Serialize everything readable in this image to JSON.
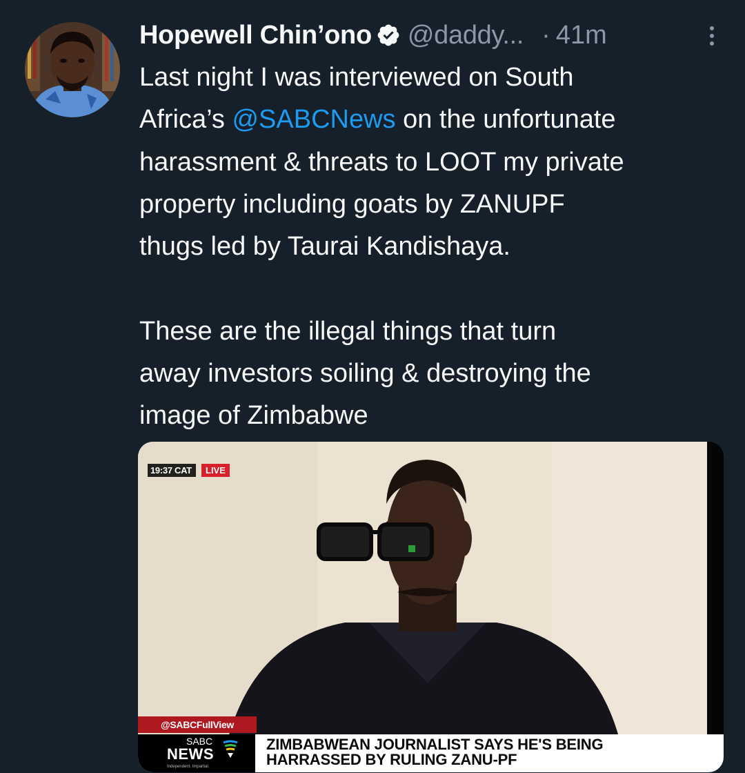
{
  "tweet": {
    "author_name": "Hopewell Chin’ono",
    "handle": "@daddy...",
    "separator": "·",
    "time": "41m",
    "text_lines": [
      "Last night I was interviewed on South",
      "Africa’s ",
      " on the unfortunate",
      "harassment & threats to LOOT my private",
      "property including goats by ZANUPF",
      "thugs led by Taurai Kandishaya.",
      "These are the illegal things that turn",
      "away investors soiling & destroying the",
      "image of Zimbabwe"
    ],
    "mention": "@SABCNews"
  },
  "video": {
    "timestamp": "19:37 CAT",
    "live_label": "LIVE",
    "channel_handle": "@SABCFullView",
    "logo_top": "SABC",
    "logo_main": "NEWS",
    "logo_tagline": "Independent. Impartial.",
    "headline_line1": "ZIMBABWEAN JOURNALIST SAYS HE'S BEING",
    "headline_line2": "HARRASSED BY RULING ZANU-PF"
  },
  "colors": {
    "background": "#15202b",
    "text": "#f7f9f9",
    "secondary_text": "#8b98a5",
    "mention": "#1d9bf0",
    "live_red": "#d8202b"
  }
}
